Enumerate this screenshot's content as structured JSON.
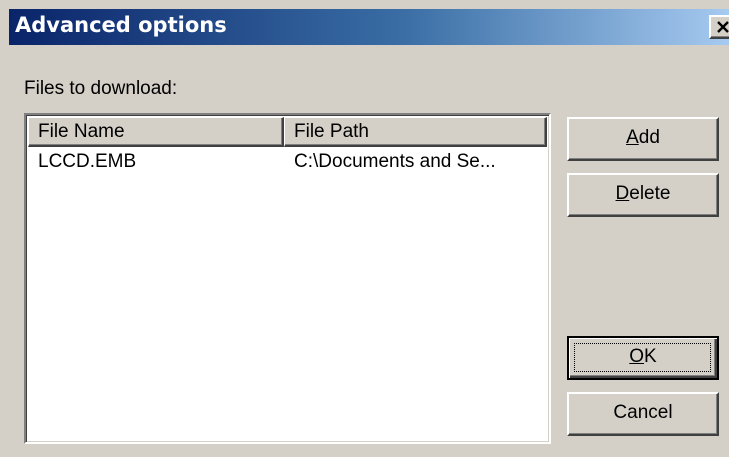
{
  "window": {
    "title": "Advanced options",
    "close_symbol": "×",
    "close_icon": "close-icon"
  },
  "files_label": "Files to download:",
  "list": {
    "columns": [
      "File Name",
      "File Path"
    ],
    "rows": [
      {
        "name": "LCCD.EMB",
        "path": "C:\\Documents and Se..."
      }
    ]
  },
  "buttons": {
    "add": {
      "mnemonic": "A",
      "rest": "dd"
    },
    "delete": {
      "mnemonic": "D",
      "rest": "elete"
    },
    "ok": {
      "mnemonic": "O",
      "rest": "K"
    },
    "cancel": "Cancel"
  },
  "colors": {
    "face": "#d4d0c8",
    "title_start": "#0a246a",
    "title_end": "#a6caf0"
  }
}
